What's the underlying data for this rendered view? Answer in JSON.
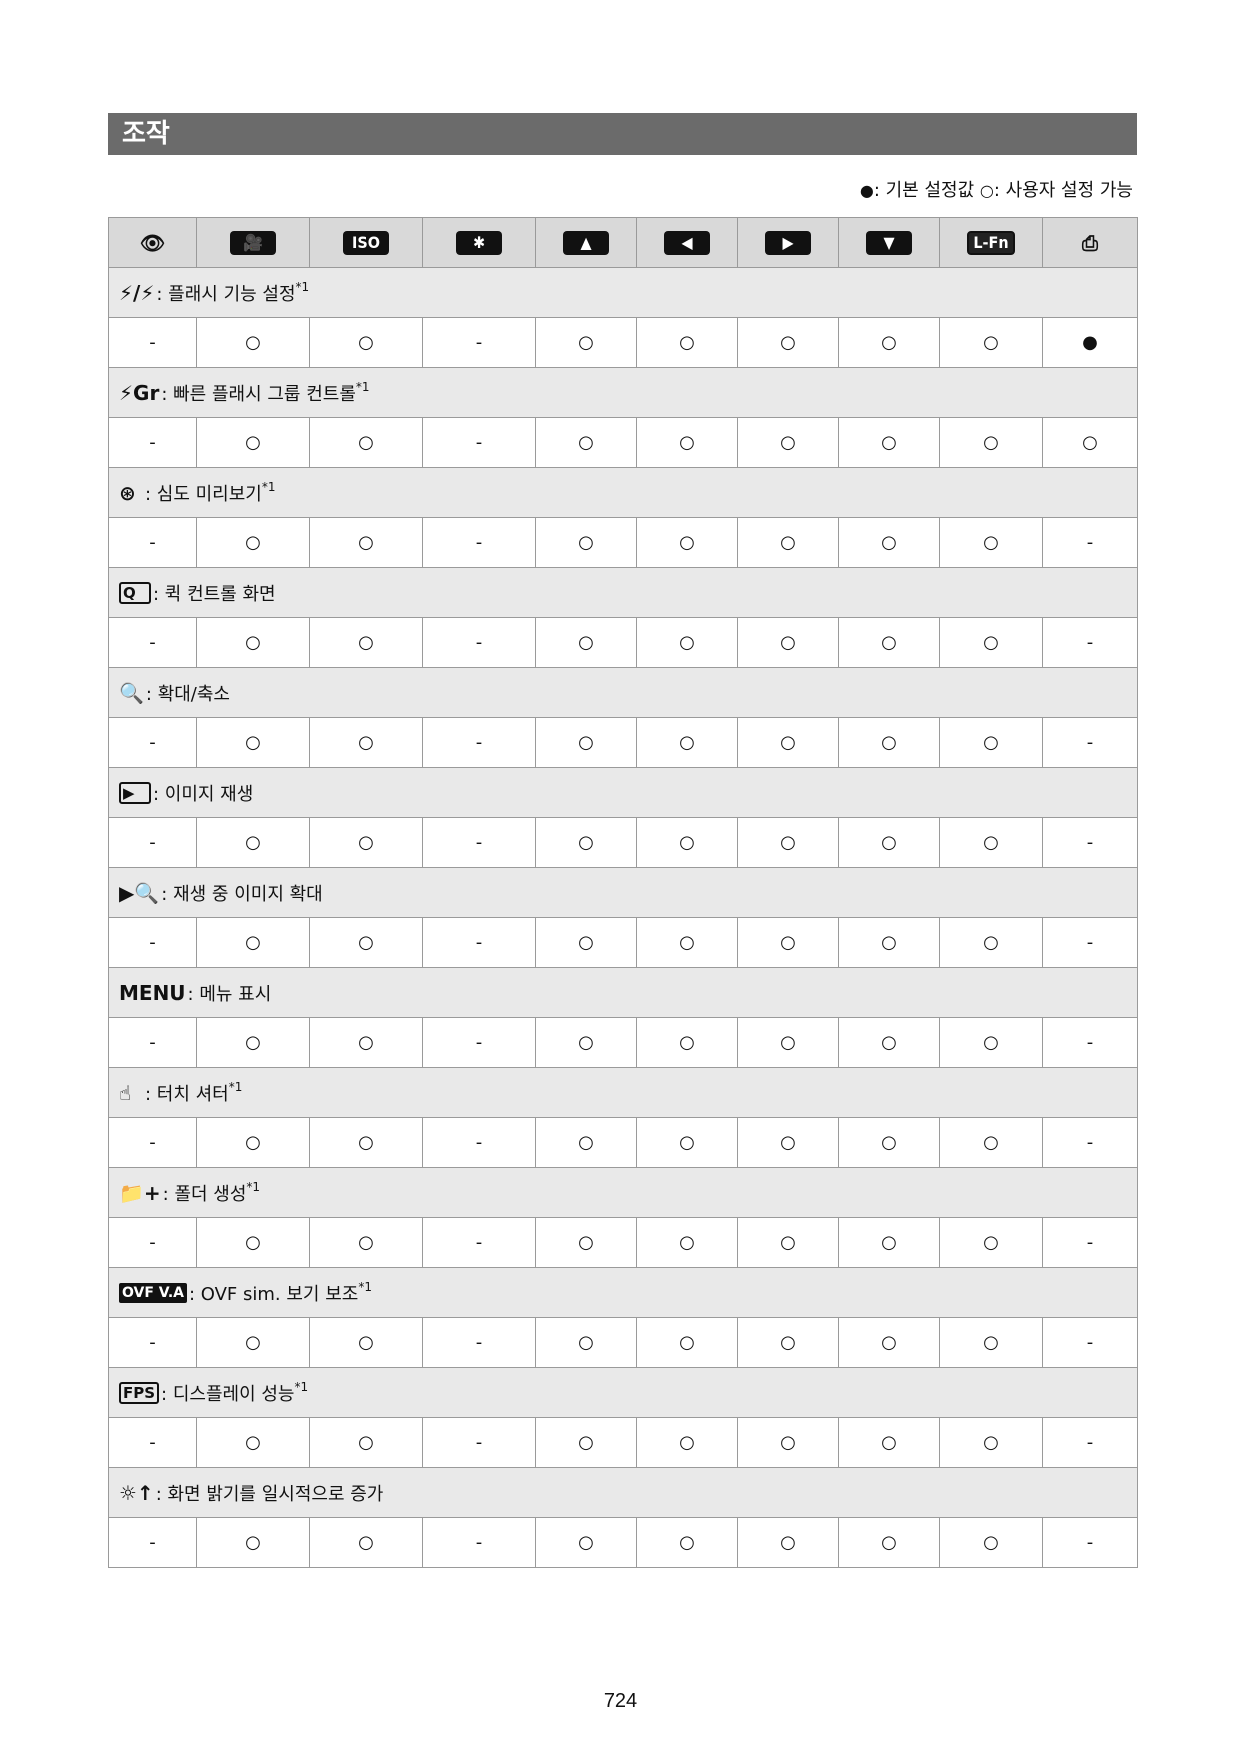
{
  "section": {
    "title": "조작"
  },
  "legend": {
    "filled_symbol": "●",
    "filled_text": ": 기본 설정값",
    "open_symbol": "○",
    "open_text": ": 사용자 설정 가능"
  },
  "columns": [
    {
      "icon": "eye-icon",
      "glyph": "👁"
    },
    {
      "icon": "movie-button-icon",
      "glyph": "🎥"
    },
    {
      "icon": "iso-button-icon",
      "glyph": "ISO"
    },
    {
      "icon": "ae-lock-button-icon",
      "glyph": "✱"
    },
    {
      "icon": "cross-key-up-icon",
      "glyph": "▲"
    },
    {
      "icon": "cross-key-left-icon",
      "glyph": "◀"
    },
    {
      "icon": "cross-key-right-icon",
      "glyph": "▶"
    },
    {
      "icon": "cross-key-down-icon",
      "glyph": "▼"
    },
    {
      "icon": "lens-function-button-icon",
      "glyph": "L-Fn"
    },
    {
      "icon": "battery-grip-icon",
      "glyph": "⎙"
    }
  ],
  "rows": [
    {
      "icon": "flash-function-settings-icon",
      "glyph": "⚡/⚡",
      "label": ": 플래시 기능 설정",
      "footnote": "*1",
      "values": [
        "-",
        "○",
        "○",
        "-",
        "○",
        "○",
        "○",
        "○",
        "○",
        "●"
      ]
    },
    {
      "icon": "quick-flash-group-control-icon",
      "glyph": "⚡Gr",
      "label": ": 빠른 플래시 그룹 컨트롤",
      "footnote": "*1",
      "values": [
        "-",
        "○",
        "○",
        "-",
        "○",
        "○",
        "○",
        "○",
        "○",
        "○"
      ]
    },
    {
      "icon": "depth-of-field-preview-icon",
      "glyph": "⊛",
      "label": ": 심도 미리보기",
      "footnote": "*1",
      "values": [
        "-",
        "○",
        "○",
        "-",
        "○",
        "○",
        "○",
        "○",
        "○",
        "-"
      ]
    },
    {
      "icon": "quick-control-icon",
      "glyph": "Q",
      "label": ": 퀵 컨트롤 화면",
      "footnote": "",
      "values": [
        "-",
        "○",
        "○",
        "-",
        "○",
        "○",
        "○",
        "○",
        "○",
        "-"
      ]
    },
    {
      "icon": "magnify-icon",
      "glyph": "🔍",
      "label": ": 확대/축소",
      "footnote": "",
      "values": [
        "-",
        "○",
        "○",
        "-",
        "○",
        "○",
        "○",
        "○",
        "○",
        "-"
      ]
    },
    {
      "icon": "playback-icon",
      "glyph": "▶",
      "label": ": 이미지 재생",
      "footnote": "",
      "values": [
        "-",
        "○",
        "○",
        "-",
        "○",
        "○",
        "○",
        "○",
        "○",
        "-"
      ]
    },
    {
      "icon": "playback-magnify-icon",
      "glyph": "▶🔍",
      "label": ": 재생 중 이미지 확대",
      "footnote": "",
      "values": [
        "-",
        "○",
        "○",
        "-",
        "○",
        "○",
        "○",
        "○",
        "○",
        "-"
      ]
    },
    {
      "icon": "menu-icon",
      "glyph": "MENU",
      "label": ": 메뉴 표시",
      "footnote": "",
      "values": [
        "-",
        "○",
        "○",
        "-",
        "○",
        "○",
        "○",
        "○",
        "○",
        "-"
      ]
    },
    {
      "icon": "touch-shutter-icon",
      "glyph": "☝",
      "label": ": 터치 셔터",
      "footnote": "*1",
      "values": [
        "-",
        "○",
        "○",
        "-",
        "○",
        "○",
        "○",
        "○",
        "○",
        "-"
      ]
    },
    {
      "icon": "create-folder-icon",
      "glyph": "📁+",
      "label": ": 폴더 생성",
      "footnote": "*1",
      "values": [
        "-",
        "○",
        "○",
        "-",
        "○",
        "○",
        "○",
        "○",
        "○",
        "-"
      ]
    },
    {
      "icon": "ovf-view-assist-icon",
      "glyph": "OVF V.A",
      "label": ": OVF sim. 보기 보조",
      "footnote": "*1",
      "values": [
        "-",
        "○",
        "○",
        "-",
        "○",
        "○",
        "○",
        "○",
        "○",
        "-"
      ]
    },
    {
      "icon": "display-performance-icon",
      "glyph": "FPS",
      "label": ": 디스플레이 성능",
      "footnote": "*1",
      "values": [
        "-",
        "○",
        "○",
        "-",
        "○",
        "○",
        "○",
        "○",
        "○",
        "-"
      ]
    },
    {
      "icon": "screen-brightness-boost-icon",
      "glyph": "☼↑",
      "label": ": 화면 밝기를 일시적으로 증가",
      "footnote": "",
      "values": [
        "-",
        "○",
        "○",
        "-",
        "○",
        "○",
        "○",
        "○",
        "○",
        "-"
      ]
    }
  ],
  "footer": {
    "page_number": "724"
  }
}
